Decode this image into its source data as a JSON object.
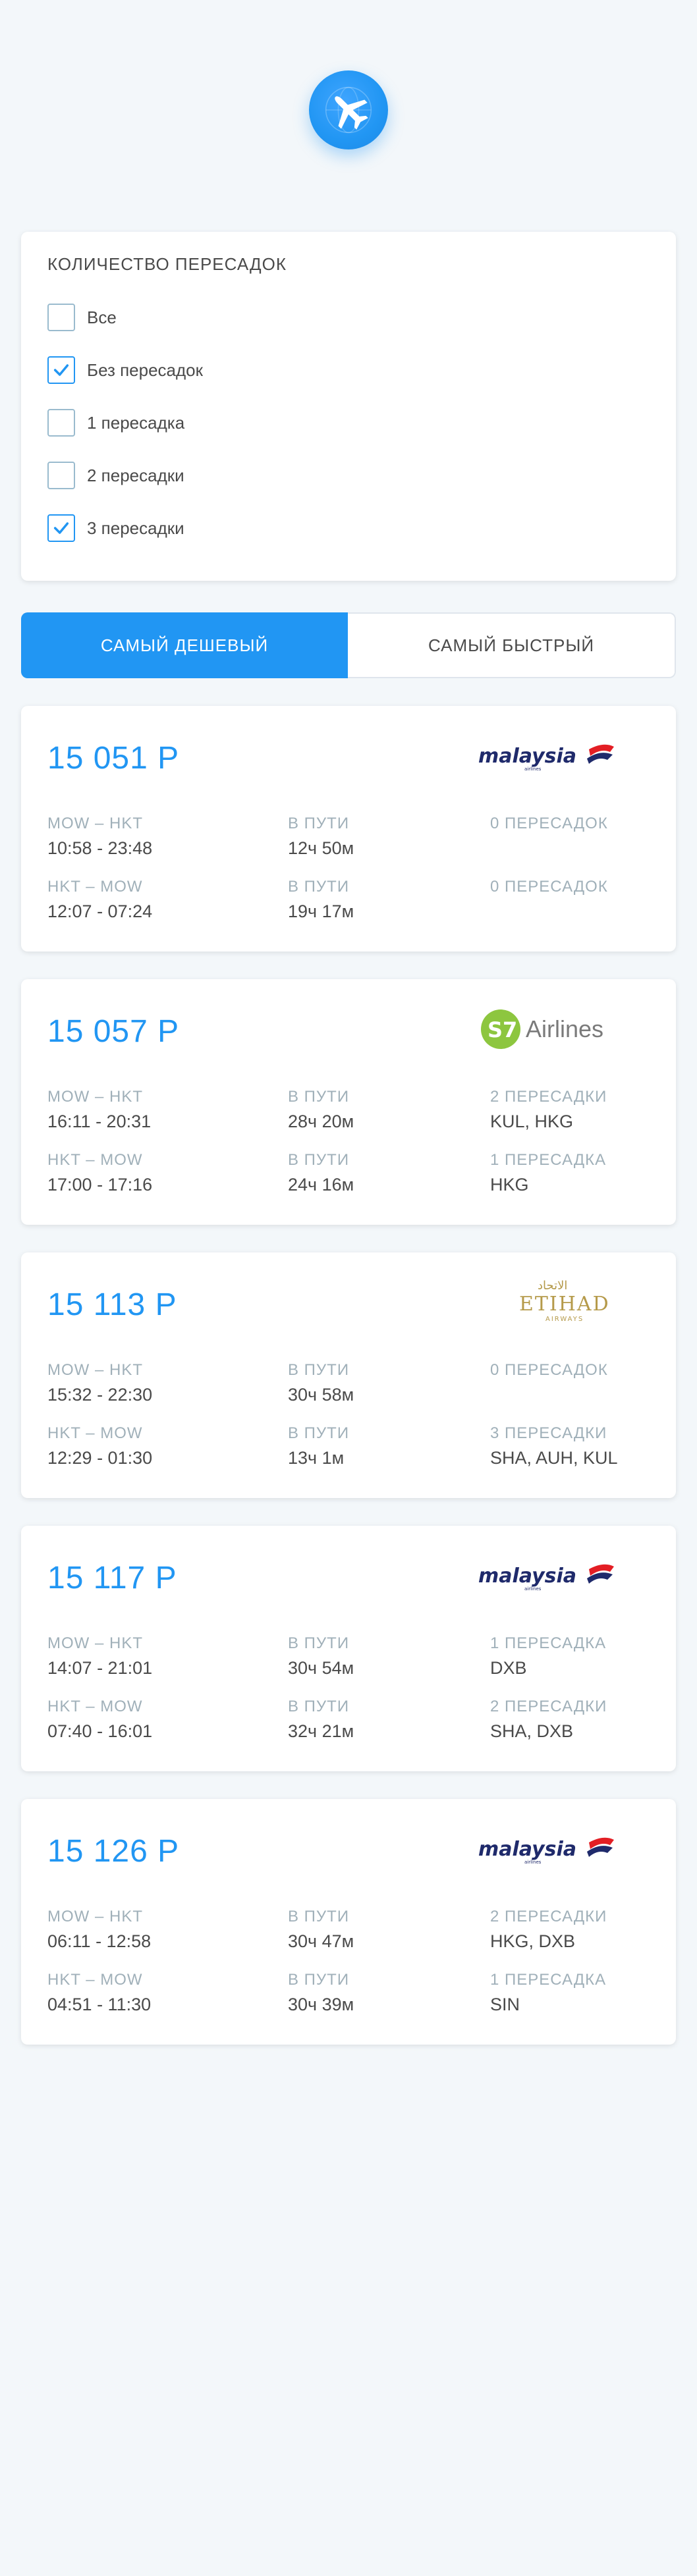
{
  "header": {
    "logo_icon": "plane-globe-icon"
  },
  "filter": {
    "title": "Количество пересадок",
    "options": [
      {
        "label": "Все",
        "checked": false
      },
      {
        "label": "Без пересадок",
        "checked": true
      },
      {
        "label": "1 пересадка",
        "checked": false
      },
      {
        "label": "2 пересадки",
        "checked": false
      },
      {
        "label": "3 пересадки",
        "checked": true
      }
    ]
  },
  "tabs": [
    {
      "label": "САМЫЙ ДЕШЕВЫЙ",
      "active": true
    },
    {
      "label": "САМЫЙ БЫСТРЫЙ",
      "active": false
    }
  ],
  "tickets": [
    {
      "price": "15 051 Р",
      "carrier": "Malaysia",
      "segments": [
        {
          "route": "MOW – HKT",
          "time": "10:58 - 23:48",
          "duration_label": "В пути",
          "duration": "12ч 50м",
          "stops_label": "0 пересадок",
          "stops": ""
        },
        {
          "route": "HKT – MOW",
          "time": "12:07 - 07:24",
          "duration_label": "В пути",
          "duration": "19ч 17м",
          "stops_label": "0 пересадок",
          "stops": ""
        }
      ]
    },
    {
      "price": "15 057 Р",
      "carrier": "S7 Airlines",
      "segments": [
        {
          "route": "MOW – HKT",
          "time": "16:11 - 20:31",
          "duration_label": "В пути",
          "duration": "28ч 20м",
          "stops_label": "2 пересадки",
          "stops": "KUL, HKG"
        },
        {
          "route": "HKT – MOW",
          "time": "17:00 - 17:16",
          "duration_label": "В пути",
          "duration": "24ч 16м",
          "stops_label": "1 пересадка",
          "stops": "HKG"
        }
      ]
    },
    {
      "price": "15 113 Р",
      "carrier": "Etihad",
      "segments": [
        {
          "route": "MOW – HKT",
          "time": "15:32 - 22:30",
          "duration_label": "В пути",
          "duration": "30ч 58м",
          "stops_label": "0 пересадок",
          "stops": ""
        },
        {
          "route": "HKT – MOW",
          "time": "12:29 - 01:30",
          "duration_label": "В пути",
          "duration": "13ч 1м",
          "stops_label": "3 пересадки",
          "stops": "SHA, AUH, KUL"
        }
      ]
    },
    {
      "price": "15 117 Р",
      "carrier": "Malaysia",
      "segments": [
        {
          "route": "MOW – HKT",
          "time": "14:07 - 21:01",
          "duration_label": "В пути",
          "duration": "30ч 54м",
          "stops_label": "1 пересадка",
          "stops": "DXB"
        },
        {
          "route": "HKT – MOW",
          "time": "07:40 - 16:01",
          "duration_label": "В пути",
          "duration": "32ч 21м",
          "stops_label": "2 пересадки",
          "stops": "SHA, DXB"
        }
      ]
    },
    {
      "price": "15 126 Р",
      "carrier": "Malaysia",
      "segments": [
        {
          "route": "MOW – HKT",
          "time": "06:11 - 12:58",
          "duration_label": "В пути",
          "duration": "30ч 47м",
          "stops_label": "2 пересадки",
          "stops": "HKG, DXB"
        },
        {
          "route": "HKT – MOW",
          "time": "04:51 - 11:30",
          "duration_label": "В пути",
          "duration": "30ч 39м",
          "stops_label": "1 пересадка",
          "stops": "SIN"
        }
      ]
    }
  ],
  "colors": {
    "accent": "#2196F3",
    "background": "#F3F7FA",
    "muted": "#A0B0B9"
  }
}
